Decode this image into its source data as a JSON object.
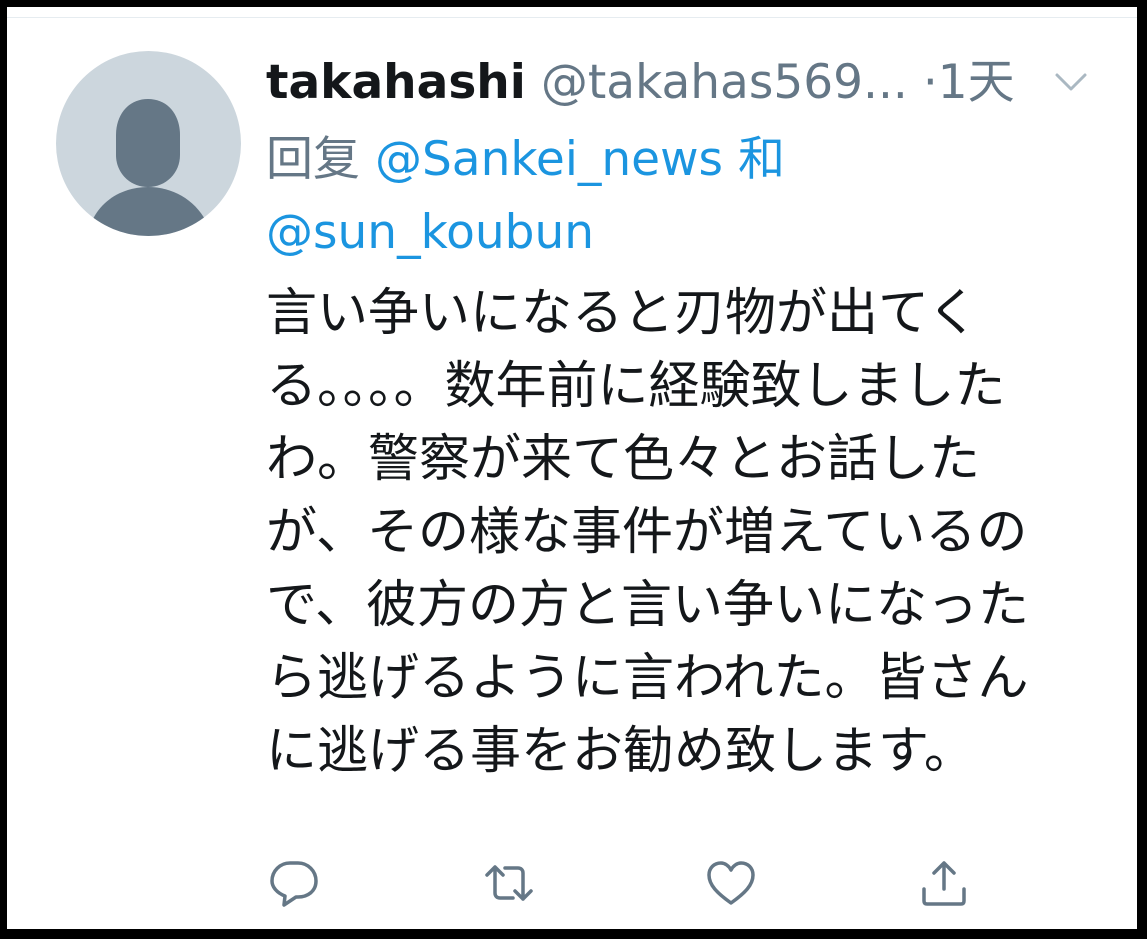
{
  "tweet": {
    "display_name": "takahashi",
    "handle": "@takahas569...",
    "separator": "·",
    "time": "1天",
    "reply_prefix": "回复",
    "reply_mention_1": "@Sankei_news",
    "reply_joiner": "和",
    "reply_mention_2": "@sun_koubun",
    "text": "言い争いになると刃物が出てくる。。。。数年前に経験致しましたわ。警察が来て色々とお話したが、その様な事件が増えているので、彼方の方と言い争いになったら逃げるように言われた。皆さんに逃げる事をお勧め致します。"
  },
  "icons": {
    "avatar": "default-avatar-icon",
    "menu": "chevron-down-icon",
    "reply": "reply-icon",
    "retweet": "retweet-icon",
    "like": "heart-icon",
    "share": "share-icon"
  },
  "colors": {
    "name": "#14171a",
    "secondary": "#657786",
    "link": "#1b95e0",
    "avatar_bg": "#ccd6dd",
    "avatar_fg": "#657786"
  }
}
